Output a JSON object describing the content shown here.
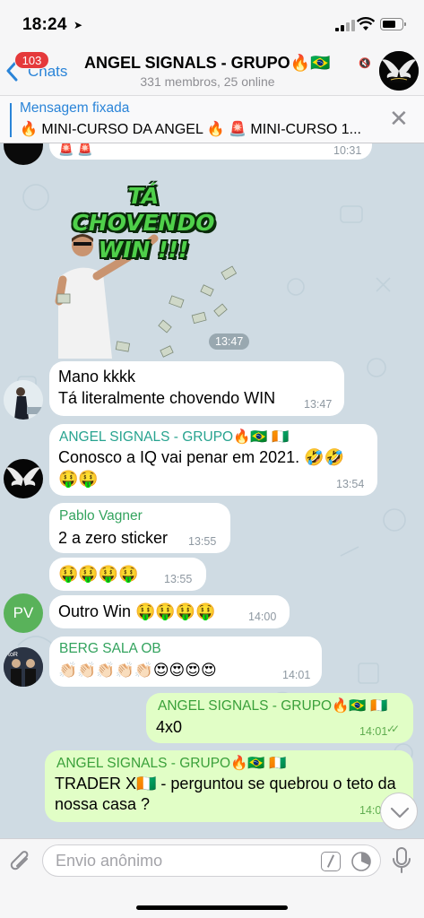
{
  "status_bar": {
    "time": "18:24"
  },
  "nav": {
    "back_label": "Chats",
    "unread_count": "103",
    "title": "ANGEL SIGNALS - GRUPO🔥🇧🇷",
    "subtitle": "331 membros, 25 online"
  },
  "pinned": {
    "title": "Mensagem fixada",
    "text": "🔥 MINI-CURSO DA ANGEL 🔥 🚨 MINI-CURSO 1..."
  },
  "messages": {
    "prev_emojis": "🚨 🚨",
    "prev_time": "10:31",
    "sticker": {
      "text": "TÁ CHOVENDO WIN !!!",
      "time": "13:47"
    },
    "m1": {
      "line1": "Mano kkkk",
      "line2": "Tá literalmente chovendo WIN",
      "time": "13:47"
    },
    "m2": {
      "sender": "ANGEL SIGNALS - GRUPO🔥🇧🇷 🇨🇮",
      "text": "Conosco a IQ vai penar em 2021. 🤣🤣",
      "text2": "🤑🤑",
      "time": "13:54"
    },
    "m3": {
      "sender": "Pablo Vagner",
      "text": "2 a zero sticker",
      "time": "13:55"
    },
    "m4": {
      "text": "🤑🤑🤑🤑",
      "time": "13:55"
    },
    "m5": {
      "avatar_initials": "PV",
      "text": "Outro Win 🤑🤑🤑🤑",
      "time": "14:00"
    },
    "m6": {
      "sender": "BERG SALA OB",
      "text": "👏🏻👏🏻👏🏻👏🏻👏🏻😍😍😍😍",
      "time": "14:01"
    },
    "m7": {
      "sender": "ANGEL SIGNALS - GRUPO🔥🇧🇷 🇨🇮",
      "text": "4x0",
      "time": "14:01"
    },
    "m8": {
      "sender": "ANGEL SIGNALS - GRUPO🔥🇧🇷 🇨🇮",
      "text": "TRADER X🇨🇮 - perguntou se quebrou o teto da nossa casa ?",
      "time": "14:0"
    }
  },
  "input": {
    "placeholder": "Envio anônimo"
  },
  "colors": {
    "accent": "#2a84d8",
    "badge": "#e5393b",
    "outgoing_bubble": "#e1fec6",
    "chat_background": "#cfdbe3",
    "angel_sender": "#27a38f",
    "other_sender": "#33a35e",
    "pv_avatar": "#59b25a"
  }
}
